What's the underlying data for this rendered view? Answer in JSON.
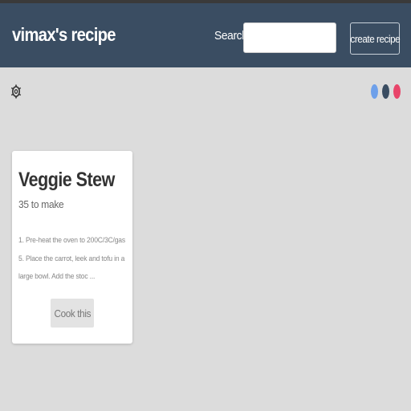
{
  "navbar": {
    "brand": "vimax's recipe",
    "search_label": "Search:",
    "search_value": "",
    "create_label": "create recipe"
  },
  "toolbar": {
    "settings_icon": "settings-gear-icon",
    "theme_colors": [
      "#6ea0ea",
      "#3a4d62",
      "#e8456a"
    ]
  },
  "recipes": [
    {
      "title": "Veggie Stew",
      "time": "35 to make",
      "description": "1. Pre-heat the oven to 200C/3C/gas 5. Place the carrot, leek and tofu in a large bowl. Add the stoc ...",
      "action_label": "Cook this"
    }
  ]
}
